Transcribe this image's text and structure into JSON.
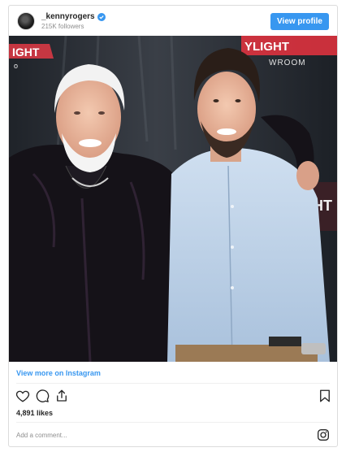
{
  "header": {
    "username": "_kennyrogers",
    "followers": "215K followers",
    "view_profile_label": "View profile"
  },
  "photo": {
    "sign_left": "IGHT",
    "sign_left_small": "o",
    "sign_right": "YLIGHT",
    "sign_right_small": "WROOM",
    "sign_lower": "IGHT"
  },
  "footer": {
    "view_more": "View more on Instagram",
    "likes": "4,891 likes",
    "comment_placeholder": "Add a comment..."
  },
  "colors": {
    "accent": "#3897f0",
    "verified": "#3897f0"
  },
  "icons": [
    "verified-badge-icon",
    "heart-icon",
    "comment-icon",
    "share-icon",
    "bookmark-icon",
    "instagram-icon"
  ]
}
